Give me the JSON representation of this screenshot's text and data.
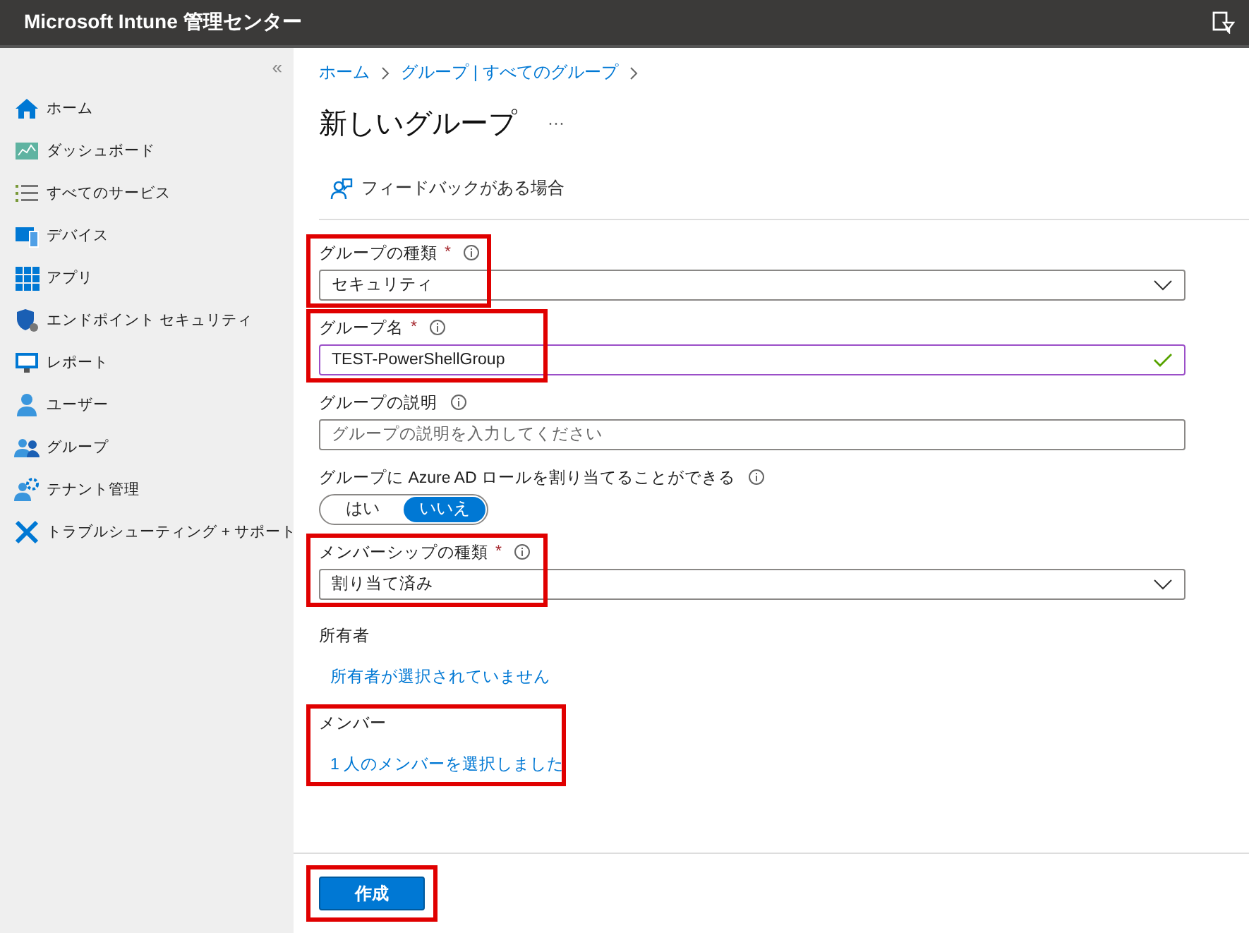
{
  "header": {
    "title": "Microsoft Intune 管理センター"
  },
  "sidebar": {
    "collapse": "«",
    "items": [
      {
        "label": "ホーム",
        "selected": false
      },
      {
        "label": "ダッシュボード",
        "selected": false
      },
      {
        "label": "すべてのサービス",
        "selected": false
      },
      {
        "label": "デバイス",
        "selected": false
      },
      {
        "label": "アプリ",
        "selected": false
      },
      {
        "label": "エンドポイント セキュリティ",
        "selected": false
      },
      {
        "label": "レポート",
        "selected": false
      },
      {
        "label": "ユーザー",
        "selected": false
      },
      {
        "label": "グループ",
        "selected": false
      },
      {
        "label": "テナント管理",
        "selected": false
      },
      {
        "label": "トラブルシューティング + サポート",
        "selected": false
      }
    ]
  },
  "breadcrumb": [
    "ホーム",
    "グループ | すべてのグループ"
  ],
  "title": "新しいグループ",
  "more": "···",
  "feedback": "フィードバックがある場合",
  "fields": [
    {
      "kind": "select",
      "label": "グループの種類",
      "required": "*",
      "info": true,
      "value": "セキュリティ",
      "highlighted": true
    },
    {
      "kind": "input",
      "label": "グループ名",
      "required": "*",
      "info": true,
      "value": "TEST-PowerShellGroup",
      "valid": true,
      "highlighted": true
    },
    {
      "kind": "input",
      "label": "グループの説明",
      "info": true,
      "placeholder": "グループの説明を入力してください",
      "valid": false,
      "highlighted": false
    },
    {
      "kind": "toggle",
      "label": "グループに Azure AD ロールを割り当てることができる",
      "info": true,
      "highlighted": false,
      "options": [
        {
          "label": "はい",
          "selected": false
        },
        {
          "label": "いいえ",
          "selected": true
        }
      ]
    },
    {
      "kind": "select",
      "label": "メンバーシップの種類",
      "required": "*",
      "info": true,
      "value": "割り当て済み",
      "highlighted": true
    },
    {
      "kind": "link",
      "label": "所有者",
      "info": false,
      "link": "所有者が選択されていません",
      "highlighted": false
    },
    {
      "kind": "link",
      "label": "メンバー",
      "info": false,
      "link": "1 人のメンバーを選択しました",
      "highlighted": true
    }
  ],
  "footer": {
    "button": "作成",
    "highlighted": true
  }
}
